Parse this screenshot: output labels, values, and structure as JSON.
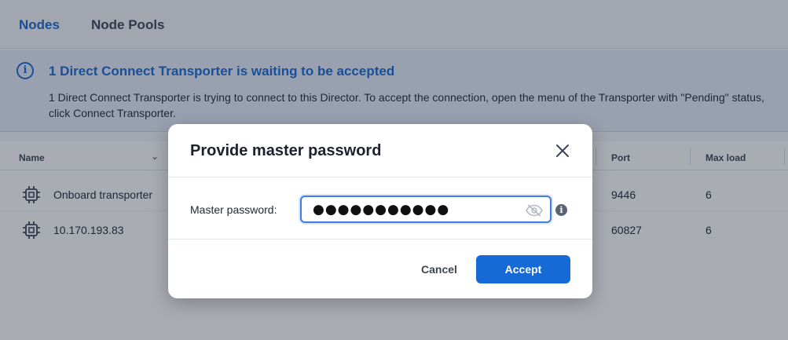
{
  "tabs": [
    {
      "label": "Nodes",
      "active": true
    },
    {
      "label": "Node Pools",
      "active": false
    }
  ],
  "banner": {
    "icon": "info-circle-icon",
    "title": "1 Direct Connect Transporter is waiting to be accepted",
    "text": "1 Direct Connect Transporter is trying to connect to this Director. To accept the connection, open the menu of the Transporter with \"Pending\" status, click Connect Transporter."
  },
  "table": {
    "columns": {
      "name": "Name",
      "port": "Port",
      "max_load": "Max load"
    },
    "rows": [
      {
        "icon": "chip-icon",
        "name": "Onboard transporter",
        "port": "9446",
        "max_load": "6"
      },
      {
        "icon": "chip-icon",
        "name": "10.170.193.83",
        "port": "60827",
        "max_load": "6"
      }
    ]
  },
  "dialog": {
    "title": "Provide master password",
    "field_label": "Master password:",
    "password_value": "●●●●●●●●●●●",
    "cancel_label": "Cancel",
    "accept_label": "Accept"
  },
  "colors": {
    "accent": "#1769d6",
    "banner_bg": "#e6eefb",
    "overlay": "rgba(30,38,56,0.38)"
  }
}
